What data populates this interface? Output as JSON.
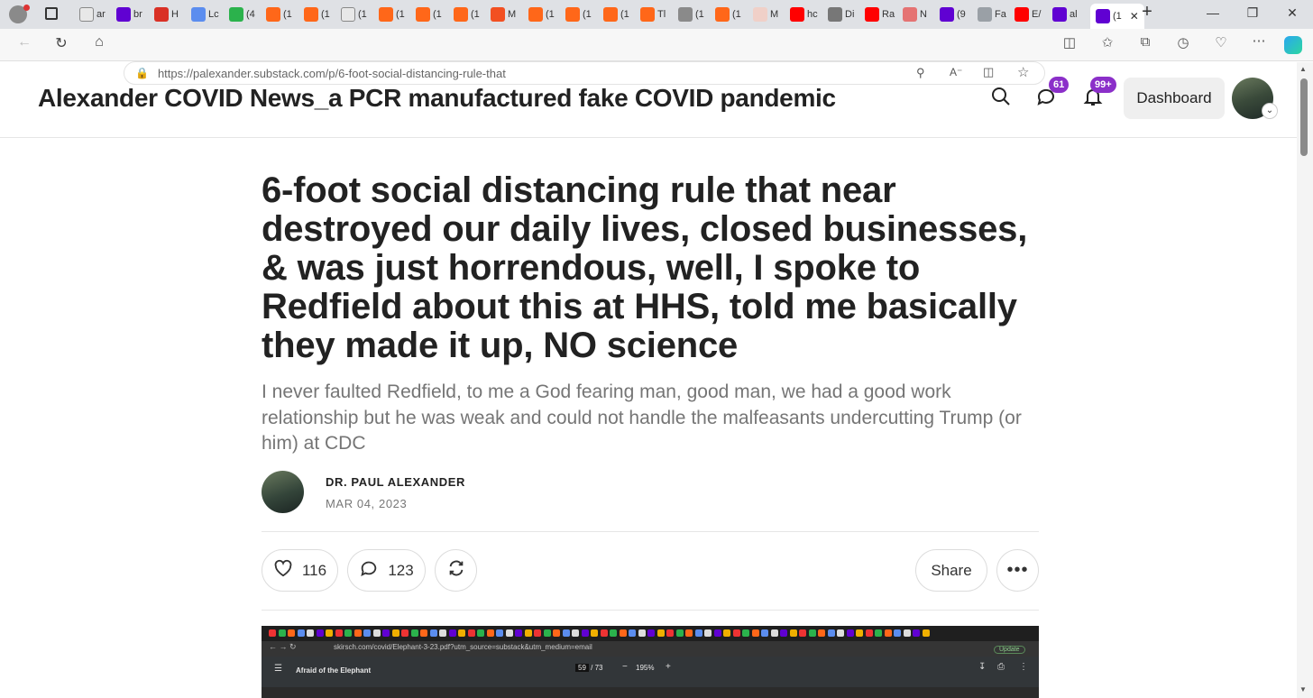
{
  "browser": {
    "tabs": [
      {
        "label": "ar",
        "icon": "document-icon"
      },
      {
        "label": "br",
        "icon": "yahoo-icon"
      },
      {
        "label": "H",
        "icon": "red-shield-icon"
      },
      {
        "label": "Lc",
        "icon": "5-icon"
      },
      {
        "label": "(4",
        "icon": "g-icon"
      },
      {
        "label": "(1",
        "icon": "substack-icon"
      },
      {
        "label": "(1",
        "icon": "substack-icon"
      },
      {
        "label": "(1",
        "icon": "document-icon"
      },
      {
        "label": "(1",
        "icon": "substack-icon"
      },
      {
        "label": "(1",
        "icon": "substack-icon"
      },
      {
        "label": "(1",
        "icon": "substack-icon"
      },
      {
        "label": "M",
        "icon": "microsoft-icon"
      },
      {
        "label": "(1",
        "icon": "substack-icon"
      },
      {
        "label": "(1",
        "icon": "substack-icon"
      },
      {
        "label": "(1",
        "icon": "substack-icon"
      },
      {
        "label": "Tl",
        "icon": "substack-icon"
      },
      {
        "label": "(1",
        "icon": "image-icon"
      },
      {
        "label": "(1",
        "icon": "substack-icon"
      },
      {
        "label": "M",
        "icon": "bi-icon"
      },
      {
        "label": "hc",
        "icon": "youtube-icon"
      },
      {
        "label": "Di",
        "icon": "stripes-icon"
      },
      {
        "label": "Ra",
        "icon": "youtube-icon"
      },
      {
        "label": "N",
        "icon": "f-icon"
      },
      {
        "label": "(9",
        "icon": "mail-icon"
      },
      {
        "label": "Fa",
        "icon": "arrow-icon"
      },
      {
        "label": "E/",
        "icon": "youtube-icon"
      },
      {
        "label": "al",
        "icon": "yahoo-icon"
      }
    ],
    "active_tab": {
      "label": "(1",
      "close": "✕"
    },
    "new_tab": "+",
    "url": "https://palexander.substack.com/p/6-foot-social-distancing-rule-that"
  },
  "site": {
    "publication_title": "Alexander COVID News_a PCR manufactured fake COVID pandemic",
    "messages_badge": "61",
    "notifications_badge": "99+",
    "dashboard_label": "Dashboard"
  },
  "post": {
    "title": "6-foot social distancing rule that near destroyed our daily lives, closed businesses, & was just horrendous, well, I spoke to Redfield about this at HHS, told me basically they made it up, NO science",
    "subtitle": "I never faulted Redfield, to me a God fearing man, good man, we had a good work relationship but he was weak and could not handle the malfeasants undercutting Trump (or him) at CDC",
    "author": "DR. PAUL ALEXANDER",
    "date": "MAR 04, 2023",
    "likes": "116",
    "comments": "123",
    "share_label": "Share"
  },
  "embed": {
    "url": "skirsch.com/covid/Elephant-3-23.pdf?utm_source=substack&utm_medium=email",
    "doc_title": "Afraid of the Elephant",
    "page": "59",
    "page_total": "/ 73",
    "zoom": "195%",
    "update_label": "Update"
  },
  "colors": {
    "accent_badge": "#8b2fc9",
    "text_primary": "#222222",
    "text_secondary": "#757575"
  }
}
